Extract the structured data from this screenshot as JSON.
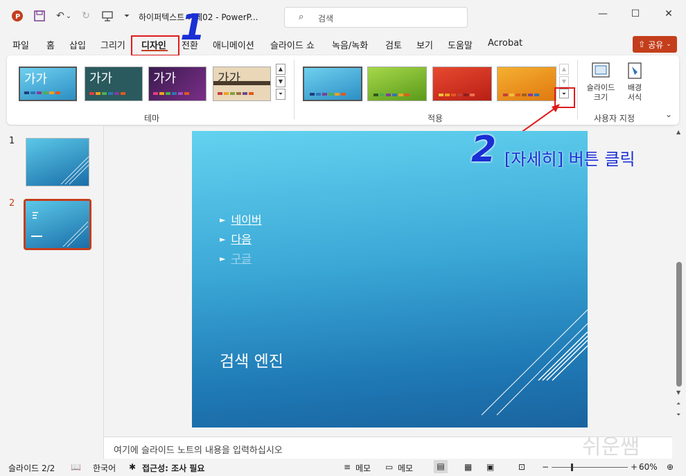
{
  "titlebar": {
    "doc_title": "하이퍼텍스트 예제02  -  PowerP...",
    "search_placeholder": "검색",
    "icons": [
      "powerpoint-logo-icon",
      "save-icon",
      "undo-icon",
      "redo-icon",
      "slideshow-icon",
      "customize-icon"
    ]
  },
  "tabs": [
    "파일",
    "홈",
    "삽입",
    "그리기",
    "디자인",
    "전환",
    "애니메이션",
    "슬라이드 쇼",
    "녹음/녹화",
    "검토",
    "보기",
    "도움말",
    "Acrobat"
  ],
  "active_tab": "디자인",
  "share_label": "공유",
  "ribbon": {
    "theme_label": "테마",
    "variants_label": "적용",
    "customize_label": "사용자 지정",
    "themes": [
      {
        "text": "가가",
        "bg": "#3bb0dd"
      },
      {
        "text": "가가",
        "bg": "#2a5a5e"
      },
      {
        "text": "가가",
        "bg": "#5a2b6e"
      },
      {
        "text": "가가",
        "bg": "#e9d7b8"
      }
    ],
    "variants": [
      {
        "bg": "#3aa7d6"
      },
      {
        "bg": "#7fbd2d"
      },
      {
        "bg": "#cf2a1e"
      },
      {
        "bg": "#f0961c"
      }
    ],
    "slide_size": "슬라이드\n크기",
    "bg_format": "배경\n서식"
  },
  "annotations": {
    "step1": "1",
    "step2": "2",
    "step2_text": "[자세히] 버튼 클릭",
    "watermark": "쉬운쌤"
  },
  "slides": [
    {
      "num": "1"
    },
    {
      "num": "2"
    }
  ],
  "slide": {
    "bullets": [
      "네이버",
      "다음",
      "구글"
    ],
    "title": "검색 엔진"
  },
  "notes_placeholder": "여기에 슬라이드 노트의 내용을 입력하십시오",
  "status": {
    "slide_count": "슬라이드 2/2",
    "language": "한국어",
    "accessibility": "접근성: 조사 필요",
    "notes_btn": "메모",
    "comments_btn": "메모",
    "zoom": "60%"
  }
}
